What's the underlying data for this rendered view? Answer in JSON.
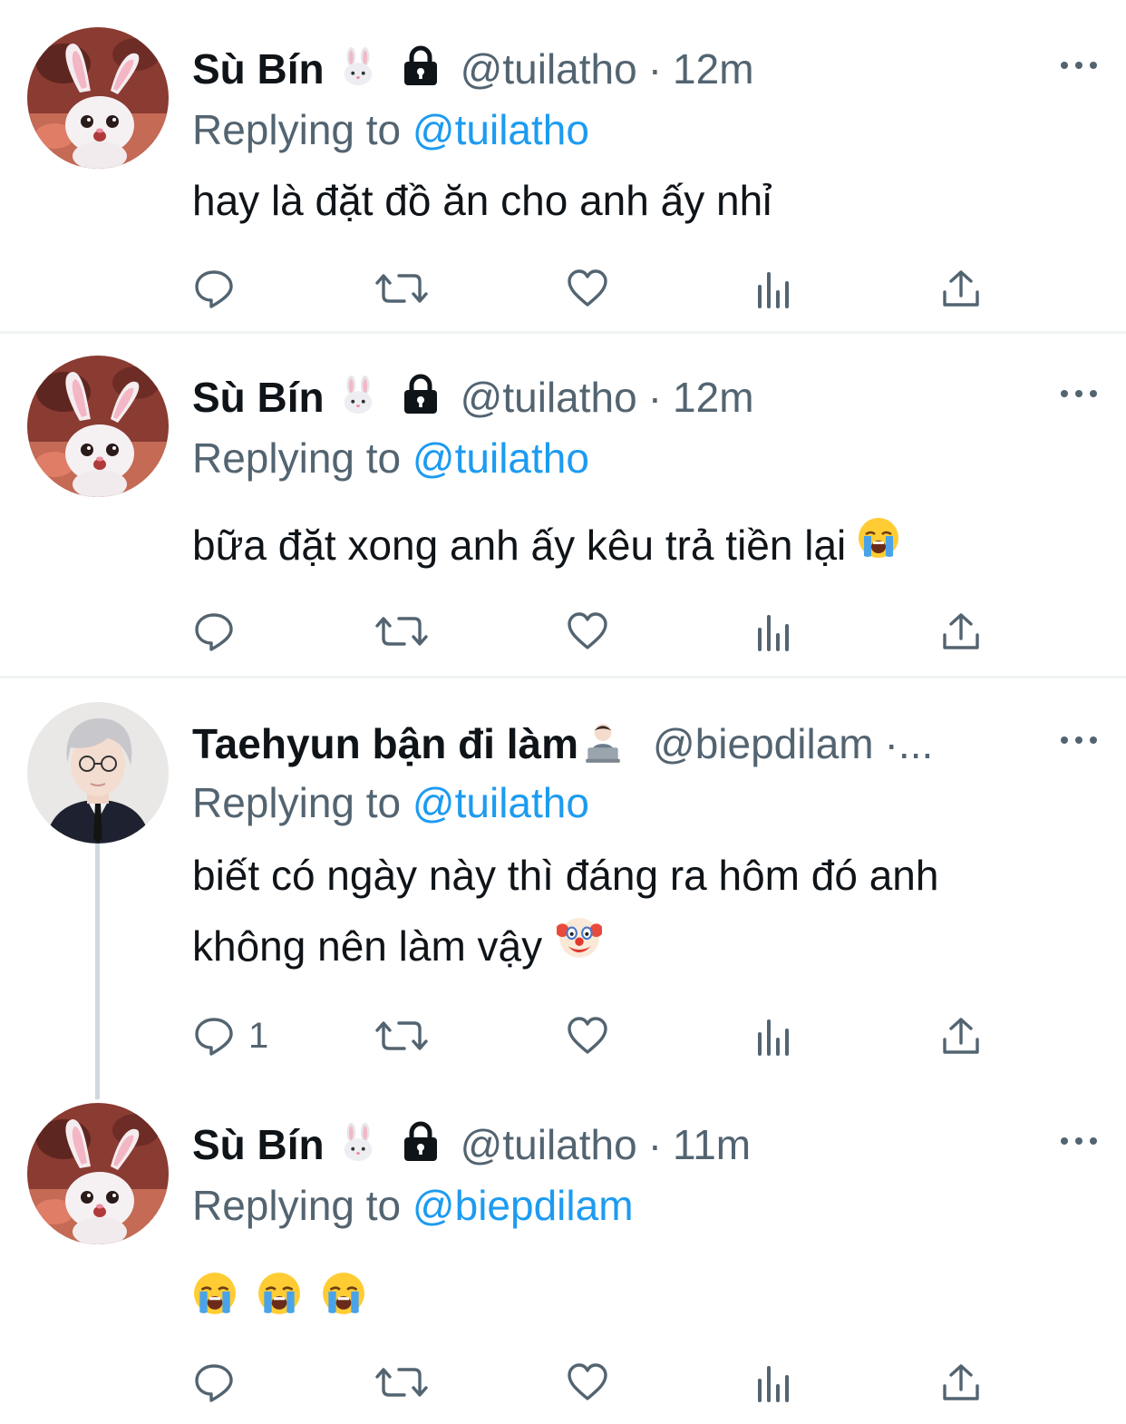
{
  "tweets": [
    {
      "name": "Sù Bín",
      "name_emoji": "rabbit-face-icon",
      "protected": true,
      "handle": "@tuilatho",
      "dot": "·",
      "time": "12m",
      "replying_prefix": "Replying to ",
      "replying_to": "@tuilatho",
      "text": "hay là đặt đồ ăn cho anh ấy nhỉ",
      "reply_count": ""
    },
    {
      "name": "Sù Bín",
      "name_emoji": "rabbit-face-icon",
      "protected": true,
      "handle": "@tuilatho",
      "dot": "·",
      "time": "12m",
      "replying_prefix": "Replying to ",
      "replying_to": "@tuilatho",
      "text": "bữa đặt xong anh ấy kêu trả tiền lại",
      "text_emoji": "crying-face-icon",
      "reply_count": ""
    },
    {
      "name": "Taehyun bận đi làm",
      "name_emoji": "person-at-laptop-icon",
      "protected": false,
      "handle": "@biepdilam",
      "dot": "·...",
      "time": "",
      "replying_prefix": "Replying to ",
      "replying_to": "@tuilatho",
      "text_line1": "biết có ngày này thì đáng ra hôm đó anh",
      "text_line2": "không nên làm vậy",
      "text_emoji": "clown-face-icon",
      "reply_count": "1"
    },
    {
      "name": "Sù Bín",
      "name_emoji": "rabbit-face-icon",
      "protected": true,
      "handle": "@tuilatho",
      "dot": "·",
      "time": "11m",
      "replying_prefix": "Replying to ",
      "replying_to": "@biepdilam",
      "emoji_text": [
        "crying-face-icon",
        "crying-face-icon",
        "crying-face-icon"
      ],
      "reply_count": ""
    }
  ],
  "colors": {
    "text": "#0f1419",
    "secondary": "#536471",
    "link": "#1d9bf0",
    "divider": "#eff3f4"
  }
}
